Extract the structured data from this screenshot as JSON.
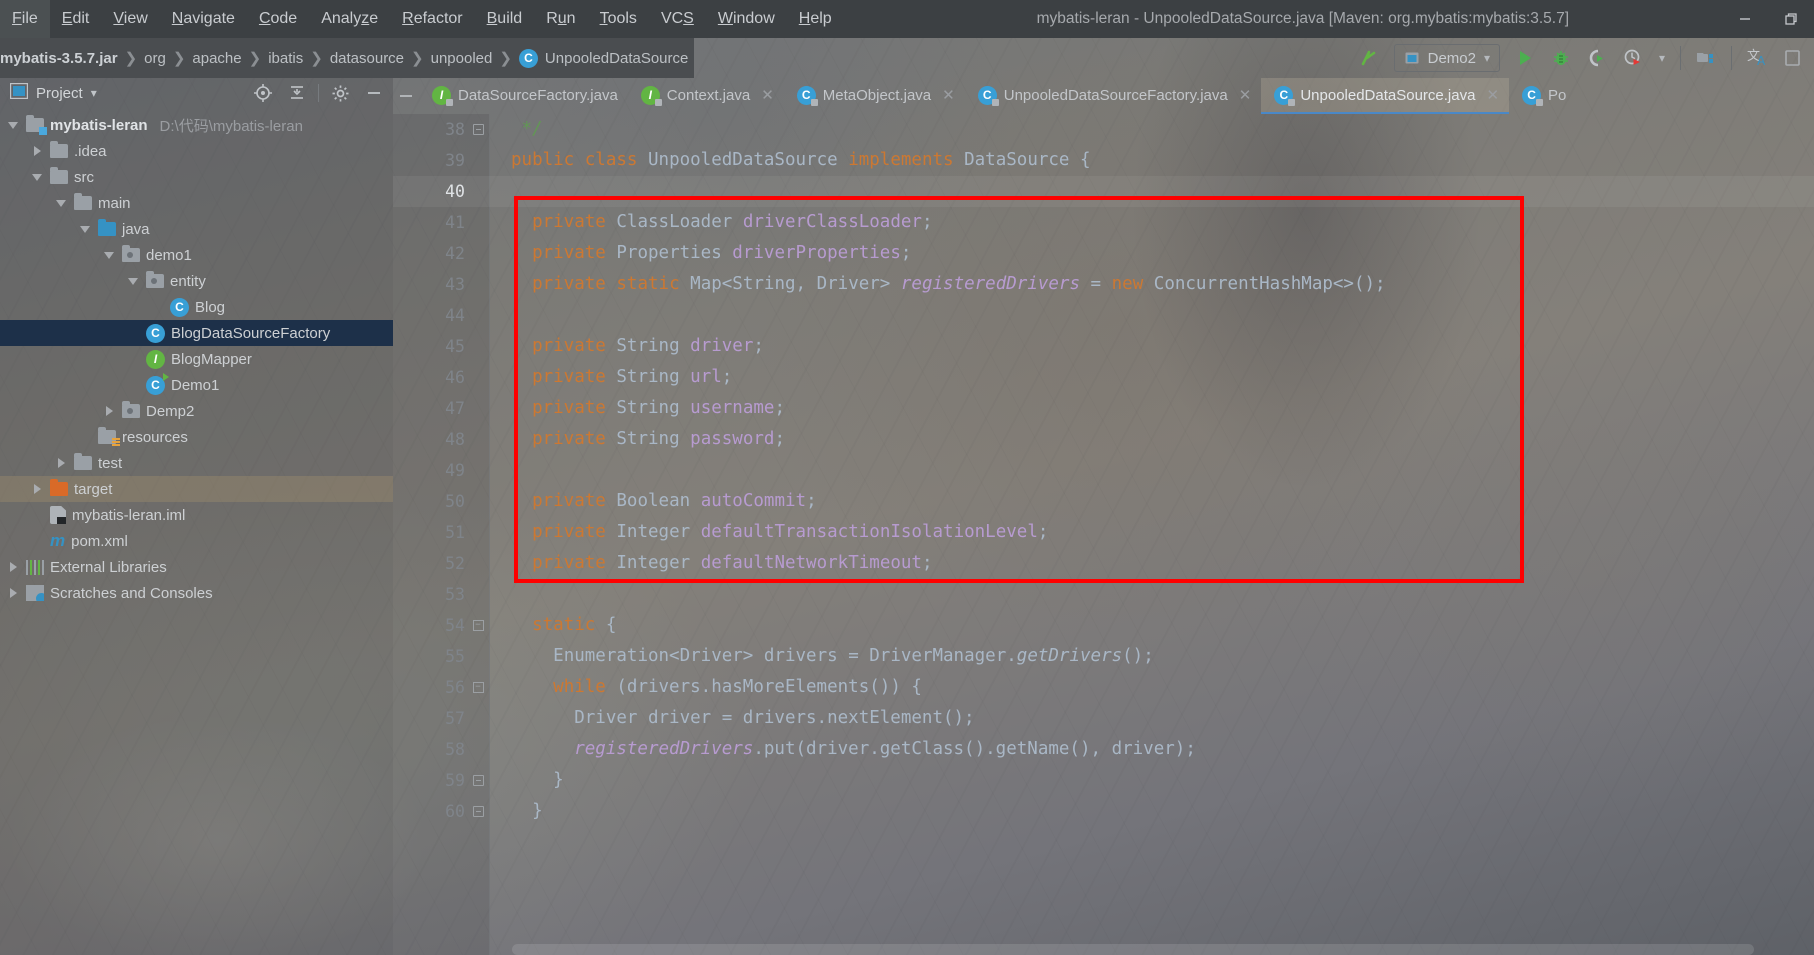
{
  "window": {
    "title": "mybatis-leran - UnpooledDataSource.java [Maven: org.mybatis:mybatis:3.5.7]",
    "minimize_label": "—",
    "restore_label": "❐"
  },
  "menubar": {
    "items": [
      {
        "label": "File",
        "mnemonic": "F"
      },
      {
        "label": "Edit",
        "mnemonic": "E"
      },
      {
        "label": "View",
        "mnemonic": "V"
      },
      {
        "label": "Navigate",
        "mnemonic": "N"
      },
      {
        "label": "Code",
        "mnemonic": "C"
      },
      {
        "label": "Analyze",
        "mnemonic": "z"
      },
      {
        "label": "Refactor",
        "mnemonic": "R"
      },
      {
        "label": "Build",
        "mnemonic": "B"
      },
      {
        "label": "Run",
        "mnemonic": "u"
      },
      {
        "label": "Tools",
        "mnemonic": "T"
      },
      {
        "label": "VCS",
        "mnemonic": "S"
      },
      {
        "label": "Window",
        "mnemonic": "W"
      },
      {
        "label": "Help",
        "mnemonic": "H"
      }
    ]
  },
  "breadcrumb": {
    "items": [
      {
        "label": "mybatis-3.5.7.jar",
        "icon": "jar-icon"
      },
      {
        "label": "org",
        "icon": "package-icon"
      },
      {
        "label": "apache",
        "icon": "package-icon"
      },
      {
        "label": "ibatis",
        "icon": "package-icon"
      },
      {
        "label": "datasource",
        "icon": "package-icon"
      },
      {
        "label": "unpooled",
        "icon": "package-icon"
      },
      {
        "label": "UnpooledDataSource",
        "icon": "class-icon",
        "badge": "C"
      }
    ],
    "separator": "❯"
  },
  "toolbar": {
    "back_icon": "back-arrow-icon",
    "run_config": {
      "label": "Demo2",
      "icon": "run-config-icon",
      "caret": "▾"
    },
    "run_icon": "run-icon",
    "debug_icon": "debug-icon",
    "run_coverage_icon": "run-with-coverage-icon",
    "profiler_icon": "profiler-icon",
    "profiler_caret": "▾",
    "project_structure_icon": "project-structure-icon",
    "translate_icon": "translate-icon",
    "search_icon": "search-everywhere-icon"
  },
  "project_panel": {
    "title": "Project",
    "title_caret": "▾",
    "window_icon": "project-window-icon",
    "locate_icon": "select-opened-file-icon",
    "collapse_icon": "collapse-all-icon",
    "settings_icon": "gear-icon",
    "hide_icon": "hide-icon",
    "tree": [
      {
        "id": "mybatis-leran",
        "label": "mybatis-leran",
        "path": "D:\\代码\\mybatis-leran",
        "depth": 0,
        "arrow": "down",
        "icon": "module-folder",
        "bold": true,
        "selected": false
      },
      {
        "id": "idea",
        "label": ".idea",
        "path": "",
        "depth": 1,
        "arrow": "right",
        "icon": "folder",
        "bold": false,
        "selected": false
      },
      {
        "id": "src",
        "label": "src",
        "path": "",
        "depth": 1,
        "arrow": "down",
        "icon": "folder",
        "bold": false,
        "selected": false
      },
      {
        "id": "main",
        "label": "main",
        "path": "",
        "depth": 2,
        "arrow": "down",
        "icon": "folder",
        "bold": false,
        "selected": false
      },
      {
        "id": "java",
        "label": "java",
        "path": "",
        "depth": 3,
        "arrow": "down",
        "icon": "source-folder",
        "bold": false,
        "selected": false
      },
      {
        "id": "demo1",
        "label": "demo1",
        "path": "",
        "depth": 4,
        "arrow": "down",
        "icon": "package-folder",
        "bold": false,
        "selected": false
      },
      {
        "id": "entity",
        "label": "entity",
        "path": "",
        "depth": 5,
        "arrow": "down",
        "icon": "package-folder",
        "bold": false,
        "selected": false
      },
      {
        "id": "Blog",
        "label": "Blog",
        "path": "",
        "depth": 6,
        "arrow": "none",
        "icon": "class-icon",
        "bold": false,
        "selected": false
      },
      {
        "id": "BlogDataSourceFactory",
        "label": "BlogDataSourceFactory",
        "path": "",
        "depth": 5,
        "arrow": "none",
        "icon": "class-icon",
        "bold": false,
        "selected": true
      },
      {
        "id": "BlogMapper",
        "label": "BlogMapper",
        "path": "",
        "depth": 5,
        "arrow": "none",
        "icon": "interface-icon",
        "bold": false,
        "selected": false
      },
      {
        "id": "Demo1",
        "label": "Demo1",
        "path": "",
        "depth": 5,
        "arrow": "none",
        "icon": "runnable-class-icon",
        "bold": false,
        "selected": false
      },
      {
        "id": "Demp2",
        "label": "Demp2",
        "path": "",
        "depth": 4,
        "arrow": "right",
        "icon": "package-folder",
        "bold": false,
        "selected": false
      },
      {
        "id": "resources",
        "label": "resources",
        "path": "",
        "depth": 3,
        "arrow": "none",
        "icon": "resources-folder",
        "bold": false,
        "selected": false
      },
      {
        "id": "test",
        "label": "test",
        "path": "",
        "depth": 2,
        "arrow": "right",
        "icon": "folder",
        "bold": false,
        "selected": false
      },
      {
        "id": "target",
        "label": "target",
        "path": "",
        "depth": 1,
        "arrow": "right",
        "icon": "excluded-folder",
        "bold": false,
        "selected": false,
        "highlight": true
      },
      {
        "id": "mybatis-leran.iml",
        "label": "mybatis-leran.iml",
        "path": "",
        "depth": 1,
        "arrow": "none",
        "icon": "iml-icon",
        "bold": false,
        "selected": false
      },
      {
        "id": "pom.xml",
        "label": "pom.xml",
        "path": "",
        "depth": 1,
        "arrow": "none",
        "icon": "maven-icon",
        "bold": false,
        "selected": false
      },
      {
        "id": "External Libraries",
        "label": "External Libraries",
        "path": "",
        "depth": 0,
        "arrow": "right",
        "icon": "libraries-icon",
        "bold": false,
        "selected": false
      },
      {
        "id": "Scratches and Consoles",
        "label": "Scratches and Consoles",
        "path": "",
        "depth": 0,
        "arrow": "right",
        "icon": "scratches-icon",
        "bold": false,
        "selected": false
      }
    ]
  },
  "editor_tabs": {
    "close_glyph": "✕",
    "minus_glyph": "—",
    "items": [
      {
        "label": "DataSourceFactory.java",
        "icon": "interface-icon",
        "active": false,
        "truncated": true
      },
      {
        "label": "Context.java",
        "icon": "interface-icon",
        "active": false
      },
      {
        "label": "MetaObject.java",
        "icon": "class-icon",
        "active": false
      },
      {
        "label": "UnpooledDataSourceFactory.java",
        "icon": "class-icon",
        "active": false
      },
      {
        "label": "UnpooledDataSource.java",
        "icon": "class-icon",
        "active": true
      },
      {
        "label": "Po",
        "icon": "class-icon",
        "active": false,
        "truncated": true
      }
    ]
  },
  "editor": {
    "current_line": 40,
    "annotation": {
      "type": "red-rectangle",
      "color": "#fe0000",
      "covers_lines": "41-52"
    },
    "lines": [
      {
        "num": 38,
        "fold": "end",
        "tokens": [
          {
            "t": " */",
            "c": "cmt"
          }
        ]
      },
      {
        "num": 39,
        "fold": "",
        "tokens": [
          {
            "t": "public",
            "c": "kw"
          },
          {
            "t": " ",
            "c": "pln"
          },
          {
            "t": "class",
            "c": "kw"
          },
          {
            "t": " ",
            "c": "pln"
          },
          {
            "t": "UnpooledDataSource",
            "c": "cls"
          },
          {
            "t": " ",
            "c": "pln"
          },
          {
            "t": "implements",
            "c": "kw"
          },
          {
            "t": " ",
            "c": "pln"
          },
          {
            "t": "DataSource",
            "c": "cls"
          },
          {
            "t": " {",
            "c": "pln"
          }
        ]
      },
      {
        "num": 40,
        "fold": "",
        "tokens": []
      },
      {
        "num": 41,
        "fold": "",
        "tokens": [
          {
            "t": "  ",
            "c": "pln"
          },
          {
            "t": "private",
            "c": "kw"
          },
          {
            "t": " ",
            "c": "pln"
          },
          {
            "t": "ClassLoader",
            "c": "cls"
          },
          {
            "t": " ",
            "c": "pln"
          },
          {
            "t": "driverClassLoader",
            "c": "fld"
          },
          {
            "t": ";",
            "c": "pln"
          }
        ]
      },
      {
        "num": 42,
        "fold": "",
        "tokens": [
          {
            "t": "  ",
            "c": "pln"
          },
          {
            "t": "private",
            "c": "kw"
          },
          {
            "t": " ",
            "c": "pln"
          },
          {
            "t": "Properties",
            "c": "cls"
          },
          {
            "t": " ",
            "c": "pln"
          },
          {
            "t": "driverProperties",
            "c": "fld"
          },
          {
            "t": ";",
            "c": "pln"
          }
        ]
      },
      {
        "num": 43,
        "fold": "",
        "tokens": [
          {
            "t": "  ",
            "c": "pln"
          },
          {
            "t": "private",
            "c": "kw"
          },
          {
            "t": " ",
            "c": "pln"
          },
          {
            "t": "static",
            "c": "kw"
          },
          {
            "t": " ",
            "c": "pln"
          },
          {
            "t": "Map<String, Driver>",
            "c": "cls"
          },
          {
            "t": " ",
            "c": "pln"
          },
          {
            "t": "registeredDrivers",
            "c": "fld-i"
          },
          {
            "t": " = ",
            "c": "pln"
          },
          {
            "t": "new",
            "c": "kw"
          },
          {
            "t": " ",
            "c": "pln"
          },
          {
            "t": "ConcurrentHashMap<>();",
            "c": "cls"
          }
        ]
      },
      {
        "num": 44,
        "fold": "",
        "tokens": []
      },
      {
        "num": 45,
        "fold": "",
        "tokens": [
          {
            "t": "  ",
            "c": "pln"
          },
          {
            "t": "private",
            "c": "kw"
          },
          {
            "t": " ",
            "c": "pln"
          },
          {
            "t": "String",
            "c": "cls"
          },
          {
            "t": " ",
            "c": "pln"
          },
          {
            "t": "driver",
            "c": "fld"
          },
          {
            "t": ";",
            "c": "pln"
          }
        ]
      },
      {
        "num": 46,
        "fold": "",
        "tokens": [
          {
            "t": "  ",
            "c": "pln"
          },
          {
            "t": "private",
            "c": "kw"
          },
          {
            "t": " ",
            "c": "pln"
          },
          {
            "t": "String",
            "c": "cls"
          },
          {
            "t": " ",
            "c": "pln"
          },
          {
            "t": "url",
            "c": "fld"
          },
          {
            "t": ";",
            "c": "pln"
          }
        ]
      },
      {
        "num": 47,
        "fold": "",
        "tokens": [
          {
            "t": "  ",
            "c": "pln"
          },
          {
            "t": "private",
            "c": "kw"
          },
          {
            "t": " ",
            "c": "pln"
          },
          {
            "t": "String",
            "c": "cls"
          },
          {
            "t": " ",
            "c": "pln"
          },
          {
            "t": "username",
            "c": "fld"
          },
          {
            "t": ";",
            "c": "pln"
          }
        ]
      },
      {
        "num": 48,
        "fold": "",
        "tokens": [
          {
            "t": "  ",
            "c": "pln"
          },
          {
            "t": "private",
            "c": "kw"
          },
          {
            "t": " ",
            "c": "pln"
          },
          {
            "t": "String",
            "c": "cls"
          },
          {
            "t": " ",
            "c": "pln"
          },
          {
            "t": "password",
            "c": "fld"
          },
          {
            "t": ";",
            "c": "pln"
          }
        ]
      },
      {
        "num": 49,
        "fold": "",
        "tokens": []
      },
      {
        "num": 50,
        "fold": "",
        "tokens": [
          {
            "t": "  ",
            "c": "pln"
          },
          {
            "t": "private",
            "c": "kw"
          },
          {
            "t": " ",
            "c": "pln"
          },
          {
            "t": "Boolean",
            "c": "cls"
          },
          {
            "t": " ",
            "c": "pln"
          },
          {
            "t": "autoCommit",
            "c": "fld"
          },
          {
            "t": ";",
            "c": "pln"
          }
        ]
      },
      {
        "num": 51,
        "fold": "",
        "tokens": [
          {
            "t": "  ",
            "c": "pln"
          },
          {
            "t": "private",
            "c": "kw"
          },
          {
            "t": " ",
            "c": "pln"
          },
          {
            "t": "Integer",
            "c": "cls"
          },
          {
            "t": " ",
            "c": "pln"
          },
          {
            "t": "defaultTransactionIsolationLevel",
            "c": "fld"
          },
          {
            "t": ";",
            "c": "pln"
          }
        ]
      },
      {
        "num": 52,
        "fold": "",
        "tokens": [
          {
            "t": "  ",
            "c": "pln"
          },
          {
            "t": "private",
            "c": "kw"
          },
          {
            "t": " ",
            "c": "pln"
          },
          {
            "t": "Integer",
            "c": "cls"
          },
          {
            "t": " ",
            "c": "pln"
          },
          {
            "t": "defaultNetworkTimeout",
            "c": "fld"
          },
          {
            "t": ";",
            "c": "pln"
          }
        ]
      },
      {
        "num": 53,
        "fold": "",
        "tokens": []
      },
      {
        "num": 54,
        "fold": "open",
        "tokens": [
          {
            "t": "  ",
            "c": "pln"
          },
          {
            "t": "static",
            "c": "kw"
          },
          {
            "t": " {",
            "c": "pln"
          }
        ]
      },
      {
        "num": 55,
        "fold": "",
        "tokens": [
          {
            "t": "    ",
            "c": "pln"
          },
          {
            "t": "Enumeration<Driver>",
            "c": "cls"
          },
          {
            "t": " ",
            "c": "pln"
          },
          {
            "t": "drivers",
            "c": "pln"
          },
          {
            "t": " = ",
            "c": "pln"
          },
          {
            "t": "DriverManager.",
            "c": "cls"
          },
          {
            "t": "getDrivers",
            "c": "mth-i"
          },
          {
            "t": "();",
            "c": "pln"
          }
        ]
      },
      {
        "num": 56,
        "fold": "open",
        "tokens": [
          {
            "t": "    ",
            "c": "pln"
          },
          {
            "t": "while",
            "c": "kw"
          },
          {
            "t": " (drivers.hasMoreElements()) {",
            "c": "pln"
          }
        ]
      },
      {
        "num": 57,
        "fold": "",
        "tokens": [
          {
            "t": "      ",
            "c": "pln"
          },
          {
            "t": "Driver",
            "c": "cls"
          },
          {
            "t": " driver = drivers.nextElement();",
            "c": "pln"
          }
        ]
      },
      {
        "num": 58,
        "fold": "",
        "tokens": [
          {
            "t": "      ",
            "c": "pln"
          },
          {
            "t": "registeredDrivers",
            "c": "fld-i"
          },
          {
            "t": ".put(driver.getClass().getName(), driver);",
            "c": "pln"
          }
        ]
      },
      {
        "num": 59,
        "fold": "end",
        "tokens": [
          {
            "t": "    }",
            "c": "pln"
          }
        ]
      },
      {
        "num": 60,
        "fold": "end",
        "tokens": [
          {
            "t": "  }",
            "c": "pln"
          }
        ]
      }
    ]
  }
}
